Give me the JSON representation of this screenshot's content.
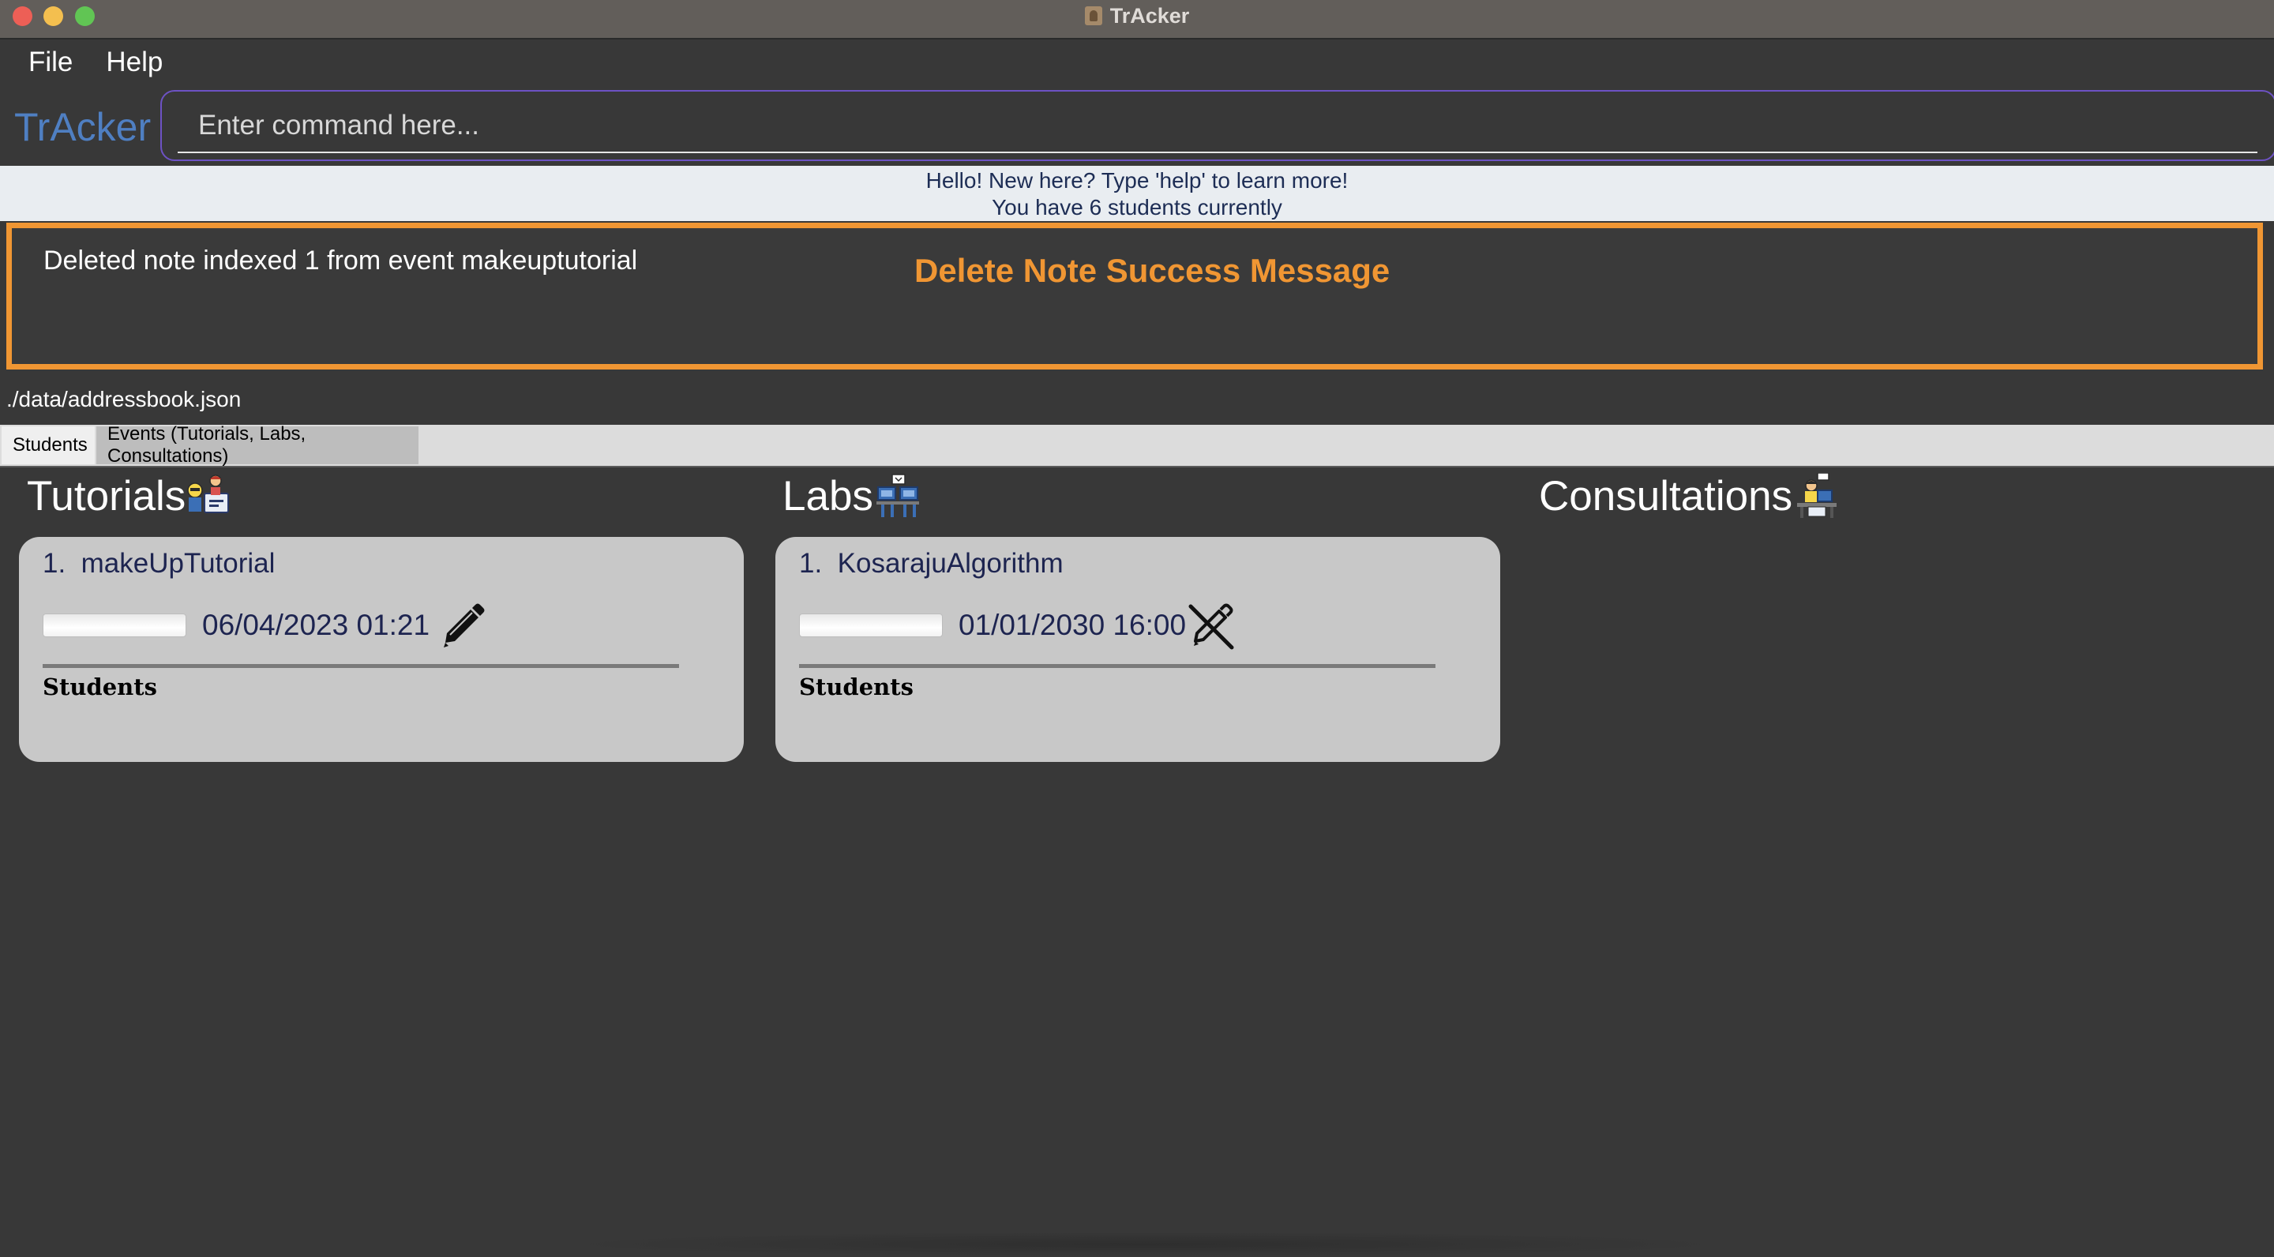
{
  "window": {
    "title": "TrAcker",
    "icon": "app-person-icon"
  },
  "menu": {
    "items": [
      "File",
      "Help"
    ]
  },
  "command": {
    "brand": "TrAcker",
    "placeholder": "Enter command here..."
  },
  "greeting": {
    "line1": "Hello! New here? Type 'help' to learn more!",
    "line2": "You have 6 students currently"
  },
  "result": {
    "message": "Deleted note indexed 1 from event makeuptutorial",
    "annotation": "Delete Note Success Message",
    "annotation_color": "#f09633"
  },
  "status": {
    "path": "./data/addressbook.json"
  },
  "tabs": [
    {
      "label": "Students",
      "selected": false
    },
    {
      "label": "Events (Tutorials, Labs, Consultations)",
      "selected": true
    }
  ],
  "columns": {
    "tutorials": {
      "title": "Tutorials",
      "icon": "teacher-whiteboard-icon",
      "cards": [
        {
          "index": "1.",
          "name": "makeUpTutorial",
          "date": "06/04/2023 01:21",
          "note_icon": "pencil-icon",
          "progress": 0.0,
          "students_label": "Students"
        }
      ]
    },
    "labs": {
      "title": "Labs",
      "icon": "lab-computers-icon",
      "cards": [
        {
          "index": "1.",
          "name": "KosarajuAlgorithm",
          "date": "01/01/2030 16:00",
          "note_icon": "pencil-slash-icon",
          "progress": 0.0,
          "students_label": "Students"
        }
      ]
    },
    "consultations": {
      "title": "Consultations",
      "icon": "consultation-desk-icon",
      "cards": []
    }
  },
  "colors": {
    "background": "#383838",
    "brand": "#4f7fc2",
    "accent_border": "#f09633",
    "command_border": "#6d52c4",
    "card": "#c8c8c8"
  }
}
